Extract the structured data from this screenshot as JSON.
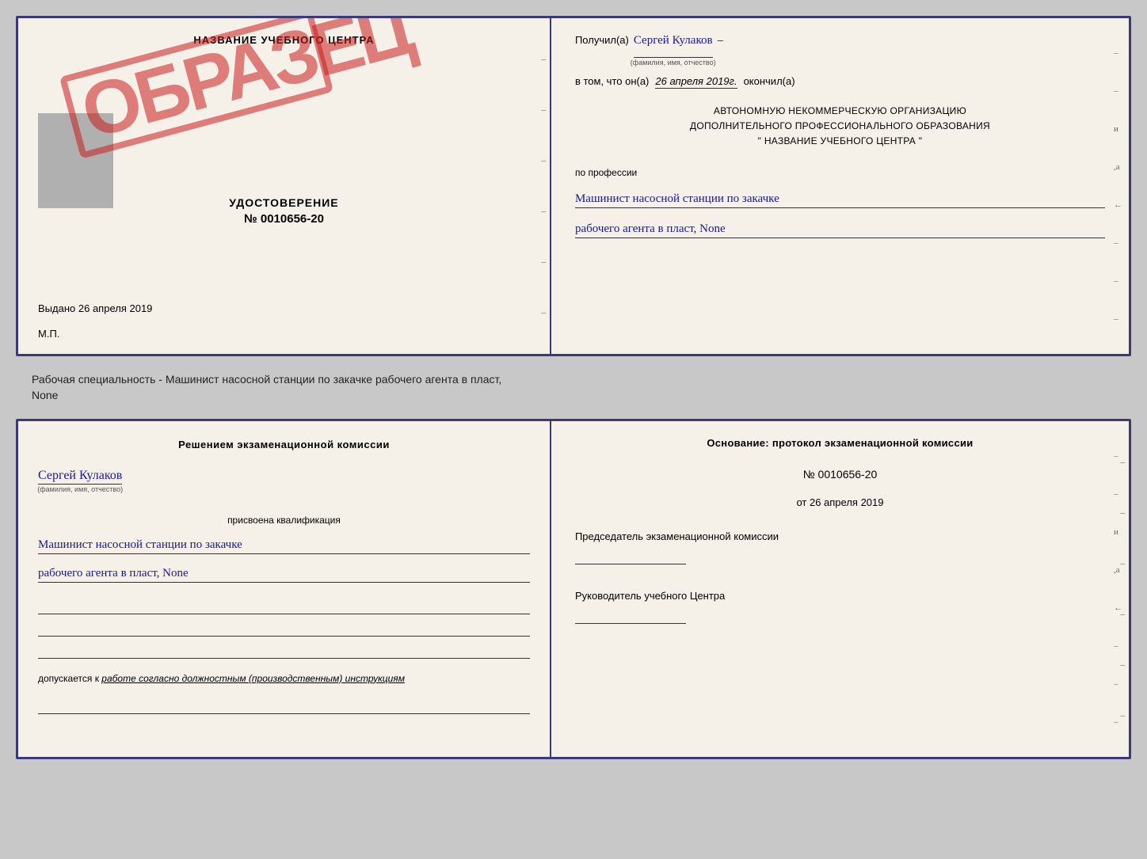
{
  "top": {
    "left": {
      "center_name": "НАЗВАНИЕ УЧЕБНОГО ЦЕНТРА",
      "udostoverenie_title": "УДОСТОВЕРЕНИЕ",
      "udostoverenie_number": "№ 0010656-20",
      "vydano_label": "Выдано",
      "vydano_date": "26 апреля 2019",
      "mp_label": "М.П.",
      "stamp_text": "ОБРАЗЕЦ"
    },
    "right": {
      "poluchil_label": "Получил(а)",
      "poluchil_name": "Сергей Кулаков",
      "poluchil_sub": "(фамилия, имя, отчество)",
      "dash": "–",
      "vtom_label": "в том, что он(а)",
      "vtom_date": "26 апреля 2019г.",
      "okonchil_label": "окончил(а)",
      "org_line1": "АВТОНОМНУЮ НЕКОММЕРЧЕСКУЮ ОРГАНИЗАЦИЮ",
      "org_line2": "ДОПОЛНИТЕЛЬНОГО ПРОФЕССИОНАЛЬНОГО ОБРАЗОВАНИЯ",
      "org_quote1": "\"",
      "org_center_name": "НАЗВАНИЕ УЧЕБНОГО ЦЕНТРА",
      "org_quote2": "\"",
      "po_professii_label": "по профессии",
      "profession1": "Машинист насосной станции по закачке",
      "profession2": "рабочего агента в пласт, None"
    }
  },
  "middle": {
    "text": "Рабочая специальность - Машинист насосной станции по закачке рабочего агента в пласт,",
    "text2": "None"
  },
  "bottom": {
    "left": {
      "resheniyem_label": "Решением экзаменационной комиссии",
      "person_name": "Сергей Кулаков",
      "person_sub": "(фамилия, имя, отчество)",
      "prisvoena_label": "присвоена квалификация",
      "qualification1": "Машинист насосной станции по закачке",
      "qualification2": "рабочего агента в пласт, None",
      "dopuskaetsya_label": "допускается к",
      "dopuskaetsya_text": "работе согласно должностным (производственным) инструкциям"
    },
    "right": {
      "osnovanie_label": "Основание: протокол экзаменационной комиссии",
      "protocol_number": "№ 0010656-20",
      "ot_label": "от",
      "ot_date": "26 апреля 2019",
      "predsedatel_label": "Председатель экзаменационной комиссии",
      "rukovoditel_label": "Руководитель учебного Центра"
    }
  }
}
